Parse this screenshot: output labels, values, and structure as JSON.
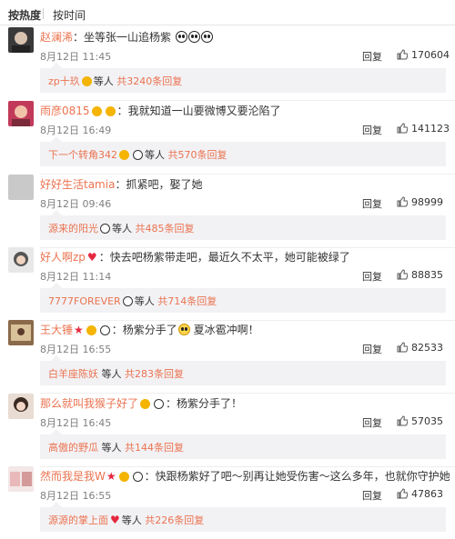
{
  "tabs": {
    "hot": "按热度",
    "time": "按时间"
  },
  "reply_label": "回复",
  "comments": [
    {
      "user": "赵澜浠",
      "text": "坐等张一山追杨紫",
      "time": "8月12日 11:45",
      "likes": "170604",
      "sub_user": "zp十玖",
      "sub_mid": "等人",
      "sub_count": "共3240条回复"
    },
    {
      "user": "雨彦0815",
      "text": "我就知道一山要微博又要沦陷了",
      "time": "8月12日 16:49",
      "likes": "141123",
      "sub_user": "下一个转角342",
      "sub_mid": "等人",
      "sub_count": "共570条回复"
    },
    {
      "user": "好好生活tamia",
      "text": "抓紧吧，娶了她",
      "time": "8月12日 09:46",
      "likes": "98999",
      "sub_user": "源来的阳光",
      "sub_mid": "等人",
      "sub_count": "共485条回复"
    },
    {
      "user": "好人啊zp",
      "text": "快去吧杨紫带走吧，最近久不太平，她可能被绿了",
      "time": "8月12日 11:14",
      "likes": "88835",
      "sub_user": "7777FOREVER",
      "sub_mid": "等人",
      "sub_count": "共714条回复"
    },
    {
      "user": "王大锤",
      "text": "杨紫分手了",
      "text2": "夏冰雹冲啊！",
      "time": "8月12日 16:55",
      "likes": "82533",
      "sub_user": "白羊座陈妖",
      "sub_mid": "等人",
      "sub_count": "共283条回复"
    },
    {
      "user": "那么就叫我猴子好了",
      "text": "杨紫分手了！",
      "time": "8月12日 16:45",
      "likes": "57035",
      "sub_user": "高傲的野瓜",
      "sub_mid": "等人",
      "sub_count": "共144条回复"
    },
    {
      "user": "然而我是我W",
      "text": "快跟杨紫好了吧～别再让她受伤害～这么多年，也就你守护她",
      "time": "8月12日 16:55",
      "likes": "47863",
      "sub_user": "源源的掌上面",
      "sub_mid": "等人",
      "sub_count": "共226条回复"
    }
  ],
  "colors": {
    "name": "#eb7350",
    "sub_bg": "#f2f2f5"
  }
}
